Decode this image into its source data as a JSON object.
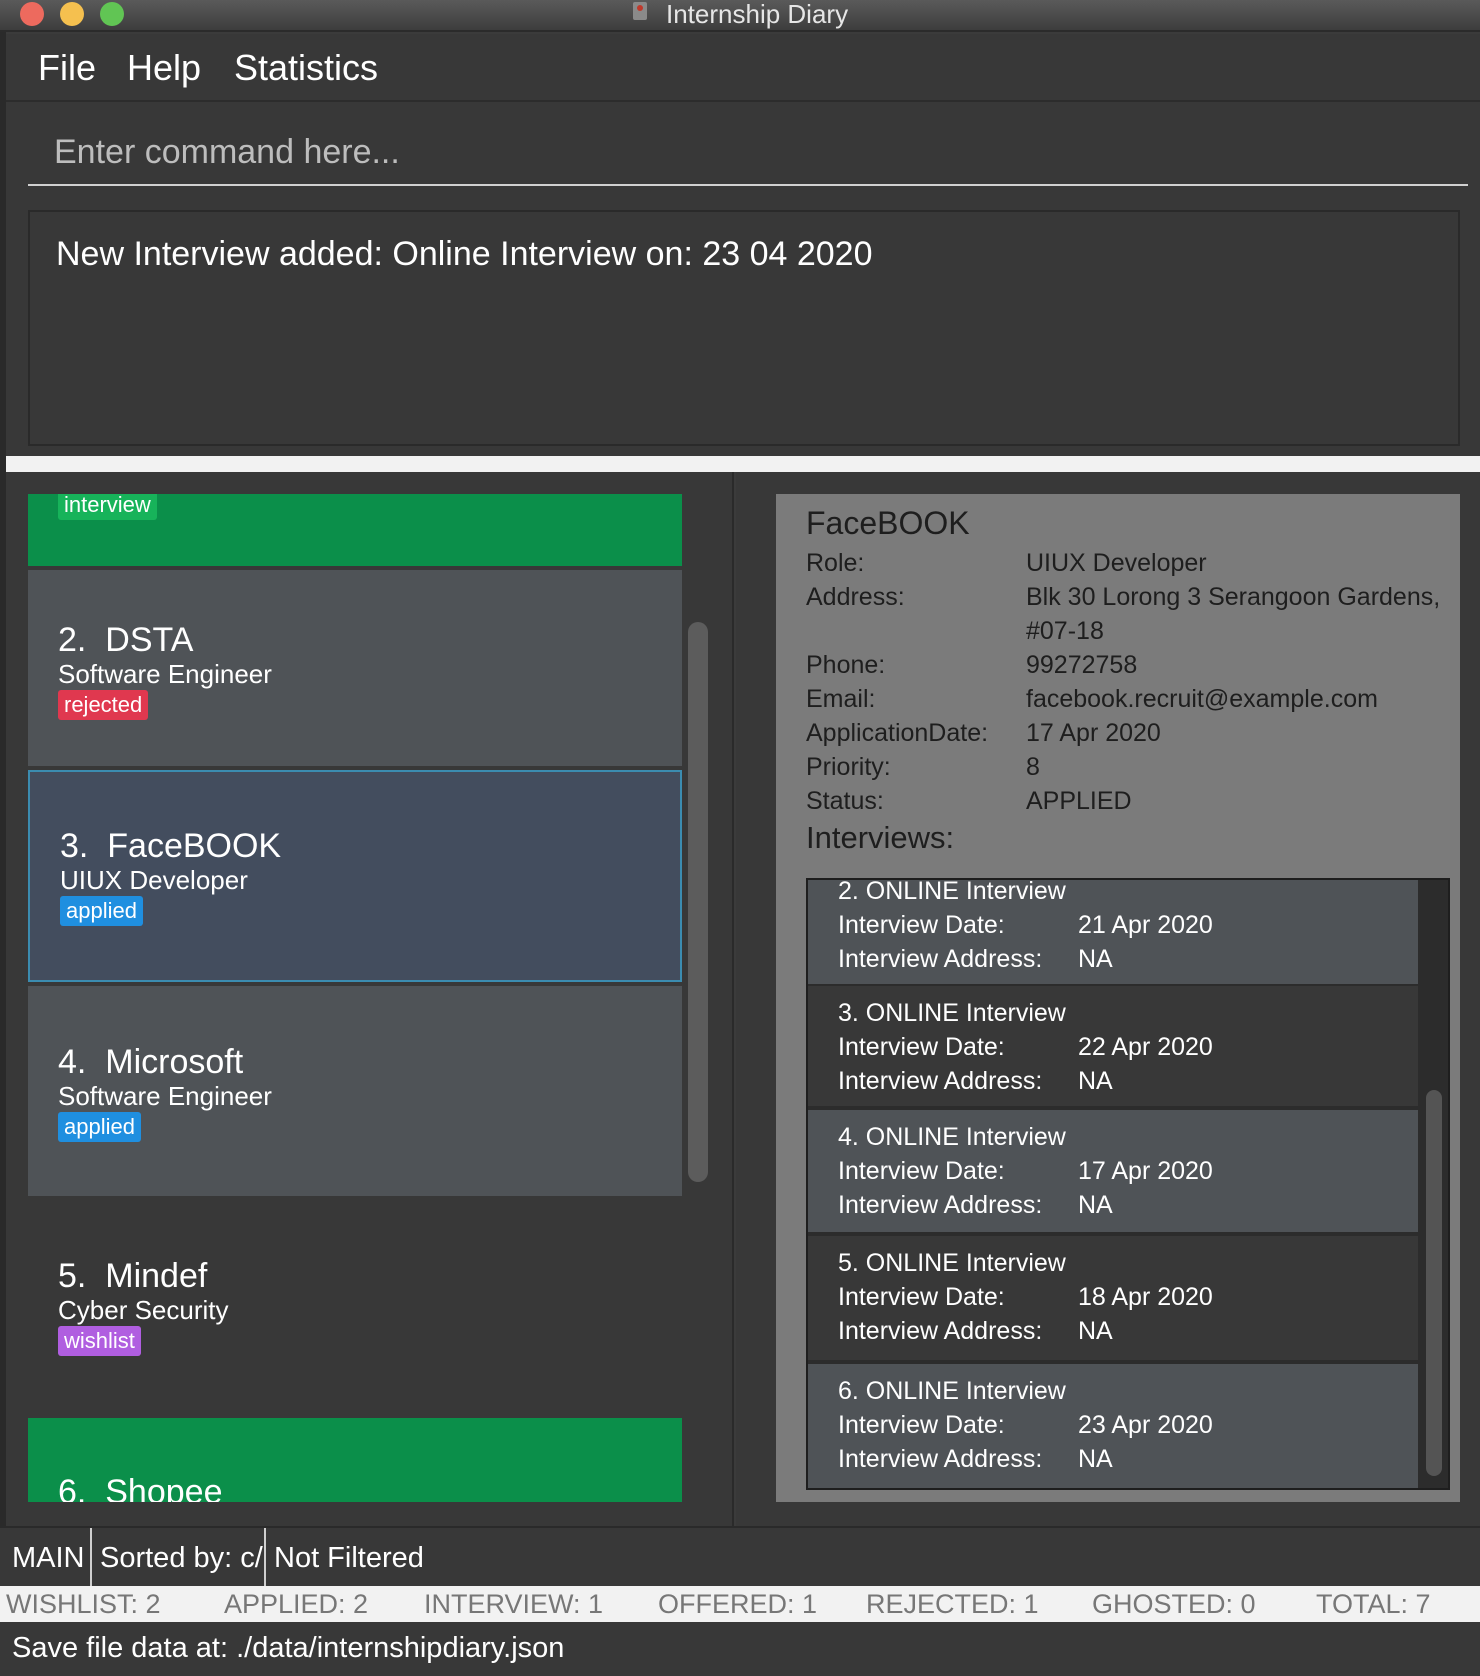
{
  "window": {
    "title": "Internship Diary"
  },
  "menu": {
    "file": "File",
    "help": "Help",
    "statistics": "Statistics"
  },
  "command": {
    "placeholder": "Enter command here..."
  },
  "result": {
    "message": "New Interview added: Online Interview on: 23 04 2020"
  },
  "list": {
    "partial_top_tag": "interview",
    "items": [
      {
        "index": "2.",
        "company": "DSTA",
        "role": "Software Engineer",
        "status": "rejected",
        "status_color": "#e0384f"
      },
      {
        "index": "3.",
        "company": "FaceBOOK",
        "role": "UIUX Developer",
        "status": "applied",
        "status_color": "#1f8fe0"
      },
      {
        "index": "4.",
        "company": "Microsoft",
        "role": "Software Engineer",
        "status": "applied",
        "status_color": "#1f8fe0"
      },
      {
        "index": "5.",
        "company": "Mindef",
        "role": "Cyber Security",
        "status": "wishlist",
        "status_color": "#b05ee0"
      }
    ],
    "partial_bottom_title": "6.  Shopee",
    "interview_card_color": "#0b8f4a",
    "selected_index": 1
  },
  "detail": {
    "company": "FaceBOOK",
    "fields": [
      {
        "label": "Role:",
        "value": "UIUX Developer"
      },
      {
        "label": "Address:",
        "value": "Blk 30 Lorong 3 Serangoon Gardens,",
        "value2": "#07-18"
      },
      {
        "label": "Phone:",
        "value": "99272758"
      },
      {
        "label": "Email:",
        "value": "facebook.recruit@example.com"
      },
      {
        "label": "ApplicationDate:",
        "value": "17 Apr 2020"
      },
      {
        "label": "Priority:",
        "value": "8"
      },
      {
        "label": "Status:",
        "value": "APPLIED"
      }
    ],
    "interviews_heading": "Interviews:",
    "interviews": [
      {
        "title": "2. ONLINE Interview",
        "date_label": "Interview Date:",
        "date": "21 Apr 2020",
        "address_label": "Interview Address:",
        "address": "NA"
      },
      {
        "title": "3. ONLINE Interview",
        "date_label": "Interview Date:",
        "date": "22 Apr 2020",
        "address_label": "Interview Address:",
        "address": "NA"
      },
      {
        "title": "4. ONLINE Interview",
        "date_label": "Interview Date:",
        "date": "17 Apr 2020",
        "address_label": "Interview Address:",
        "address": "NA"
      },
      {
        "title": "5. ONLINE Interview",
        "date_label": "Interview Date:",
        "date": "18 Apr 2020",
        "address_label": "Interview Address:",
        "address": "NA"
      },
      {
        "title": "6. ONLINE Interview",
        "date_label": "Interview Date:",
        "date": "23 Apr 2020",
        "address_label": "Interview Address:",
        "address": "NA"
      }
    ]
  },
  "status": {
    "view": "MAIN",
    "sort": "Sorted by: c/",
    "filter": "Not Filtered"
  },
  "stats": {
    "wishlist": "WISHLIST: 2",
    "applied": "APPLIED: 2",
    "interview": "INTERVIEW: 1",
    "offered": "OFFERED: 1",
    "rejected": "REJECTED: 1",
    "ghosted": "GHOSTED: 0",
    "total": "TOTAL: 7"
  },
  "save": {
    "path": "Save file data at: ./data/internshipdiary.json"
  }
}
